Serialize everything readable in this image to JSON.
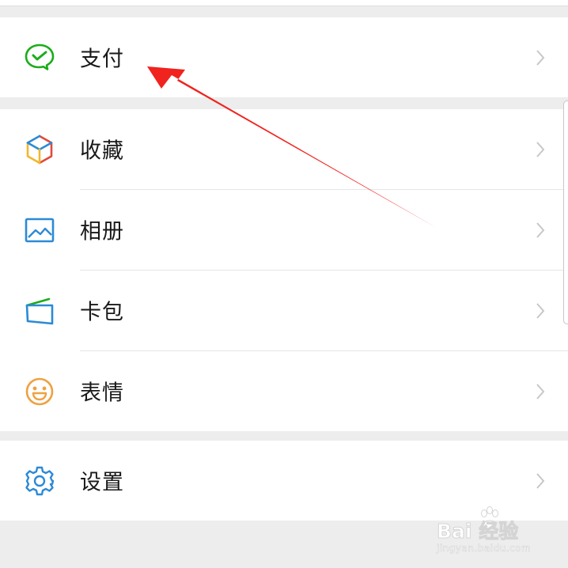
{
  "menu": {
    "groups": [
      {
        "items": [
          {
            "label": "支付",
            "icon": "wechat-pay-icon"
          }
        ]
      },
      {
        "items": [
          {
            "label": "收藏",
            "icon": "favorites-cube-icon"
          },
          {
            "label": "相册",
            "icon": "album-picture-icon"
          },
          {
            "label": "卡包",
            "icon": "card-wallet-icon"
          },
          {
            "label": "表情",
            "icon": "emoji-smile-icon"
          }
        ]
      },
      {
        "items": [
          {
            "label": "设置",
            "icon": "settings-gear-icon"
          }
        ]
      }
    ]
  },
  "annotation": {
    "arrow_color": "#f0231e",
    "points_to": "支付"
  },
  "watermark": {
    "brand": "Bai 经验",
    "url": "jingyan.baidu.com"
  },
  "colors": {
    "pay_green": "#1aad19",
    "link_blue": "#2b8ad6",
    "emoji_orange": "#f0a040",
    "background": "#ededed",
    "row_background": "#ffffff",
    "text": "#191919",
    "chevron": "#c7c7c7"
  }
}
